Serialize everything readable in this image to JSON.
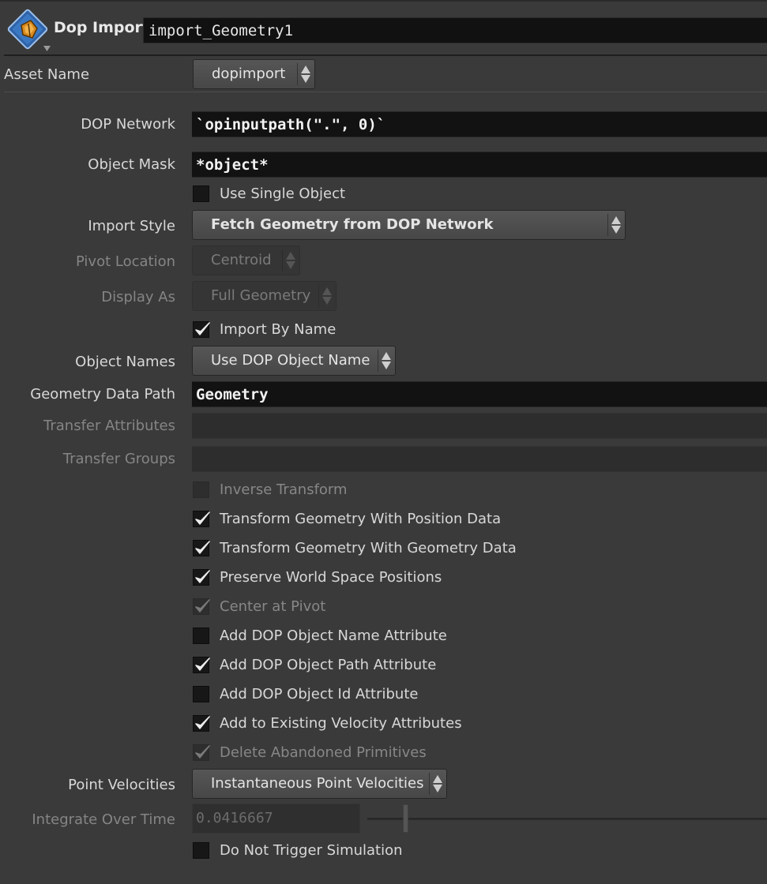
{
  "header": {
    "node_type": "Dop Import",
    "node_name": "import_Geometry1",
    "icon": "dop-import-node-icon"
  },
  "asset": {
    "label": "Asset Name",
    "value": "dopimport"
  },
  "params": {
    "dop_network": {
      "label": "DOP Network",
      "value": "`opinputpath(\".\", 0)`"
    },
    "object_mask": {
      "label": "Object Mask",
      "value": "*object*"
    },
    "use_single_object": {
      "label": "Use Single Object",
      "checked": false
    },
    "import_style": {
      "label": "Import Style",
      "value": "Fetch Geometry from DOP Network"
    },
    "pivot_location": {
      "label": "Pivot Location",
      "value": "Centroid",
      "disabled": true
    },
    "display_as": {
      "label": "Display As",
      "value": "Full Geometry",
      "disabled": true
    },
    "import_by_name": {
      "label": "Import By Name",
      "checked": true
    },
    "object_names": {
      "label": "Object Names",
      "value": "Use DOP Object Name"
    },
    "geometry_data_path": {
      "label": "Geometry Data Path",
      "value": "Geometry"
    },
    "transfer_attributes": {
      "label": "Transfer Attributes",
      "value": "",
      "disabled": true
    },
    "transfer_groups": {
      "label": "Transfer Groups",
      "value": "",
      "disabled": true
    },
    "inverse_transform": {
      "label": "Inverse Transform",
      "checked": false,
      "disabled": true
    },
    "transform_position": {
      "label": "Transform Geometry With Position Data",
      "checked": true
    },
    "transform_geometry": {
      "label": "Transform Geometry With Geometry Data",
      "checked": true
    },
    "preserve_world": {
      "label": "Preserve World Space Positions",
      "checked": true
    },
    "center_at_pivot": {
      "label": "Center at Pivot",
      "checked": true,
      "disabled": true
    },
    "add_name_attr": {
      "label": "Add DOP Object Name Attribute",
      "checked": false
    },
    "add_path_attr": {
      "label": "Add DOP Object Path Attribute",
      "checked": true
    },
    "add_id_attr": {
      "label": "Add DOP Object Id Attribute",
      "checked": false
    },
    "add_velocity": {
      "label": "Add to Existing Velocity Attributes",
      "checked": true
    },
    "delete_abandoned": {
      "label": "Delete Abandoned Primitives",
      "checked": true,
      "disabled": true
    },
    "point_velocities": {
      "label": "Point Velocities",
      "value": "Instantaneous Point Velocities"
    },
    "integrate_over_time": {
      "label": "Integrate Over Time",
      "value": "0.0416667",
      "disabled": true
    },
    "do_not_trigger": {
      "label": "Do Not Trigger Simulation",
      "checked": false
    }
  },
  "colors": {
    "panel_bg": "#3a3a3a",
    "field_bg": "#121212",
    "node_icon_orange": "#d98a1f",
    "node_icon_blue": "#2f63a8"
  }
}
